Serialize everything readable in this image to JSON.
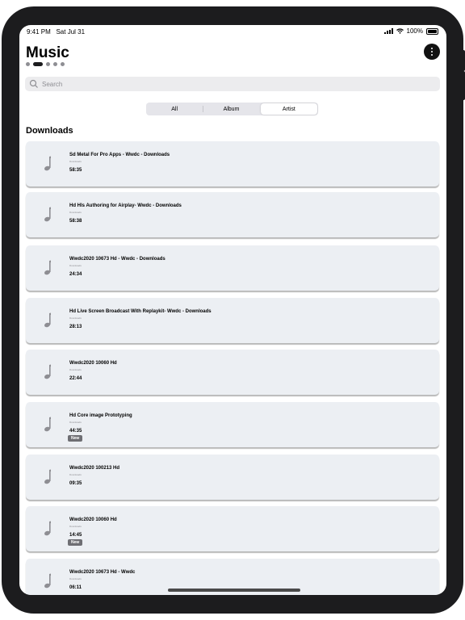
{
  "status_bar": {
    "time": "9:41 PM",
    "date": "Sat Jul 31",
    "battery": "100%"
  },
  "header": {
    "title": "Music",
    "page_dots": 5,
    "active_dot": 1
  },
  "search": {
    "placeholder": "Search",
    "value": ""
  },
  "segments": [
    {
      "label": "All",
      "selected": false
    },
    {
      "label": "Album",
      "selected": false
    },
    {
      "label": "Artist",
      "selected": true
    }
  ],
  "section": {
    "title": "Downloads"
  },
  "items": [
    {
      "title": "Sd Metal For Pro Apps - Wwdc - Downloads",
      "subtitle": "Downloads",
      "duration": "58:35",
      "badge": ""
    },
    {
      "title": "Hd Hls Authoring for Airplay- Wwdc - Downloads",
      "subtitle": "Downloads",
      "duration": "58:38",
      "badge": ""
    },
    {
      "title": "Wwdc2020 10673 Hd - Wwdc - Downloads",
      "subtitle": "Downloads",
      "duration": "24:34",
      "badge": ""
    },
    {
      "title": "Hd Live Screen Broadcast With Replaykit- Wwdc - Downloads",
      "subtitle": "Downloads",
      "duration": "28:13",
      "badge": ""
    },
    {
      "title": "Wwdc2020 10060 Hd",
      "subtitle": "Downloads",
      "duration": "22:44",
      "badge": ""
    },
    {
      "title": "Hd Core image Prototyping",
      "subtitle": "Downloads",
      "duration": "44:35",
      "badge": "New"
    },
    {
      "title": "Wwdc2020 100213 Hd",
      "subtitle": "Downloads",
      "duration": "09:35",
      "badge": ""
    },
    {
      "title": "Wwdc2020 10060 Hd",
      "subtitle": "Downloads",
      "duration": "14:45",
      "badge": "New"
    },
    {
      "title": "Wwdc2020 10673 Hd - Wwdc",
      "subtitle": "Downloads",
      "duration": "06:11",
      "badge": ""
    }
  ],
  "colors": {
    "card_bg": "#eceff3",
    "badge_bg": "#6e6e73",
    "accent": "#1c1c1e"
  },
  "icons": {
    "item_icon": "music-note-icon",
    "menu_icon": "more-vertical-icon",
    "search_icon": "search-icon"
  }
}
